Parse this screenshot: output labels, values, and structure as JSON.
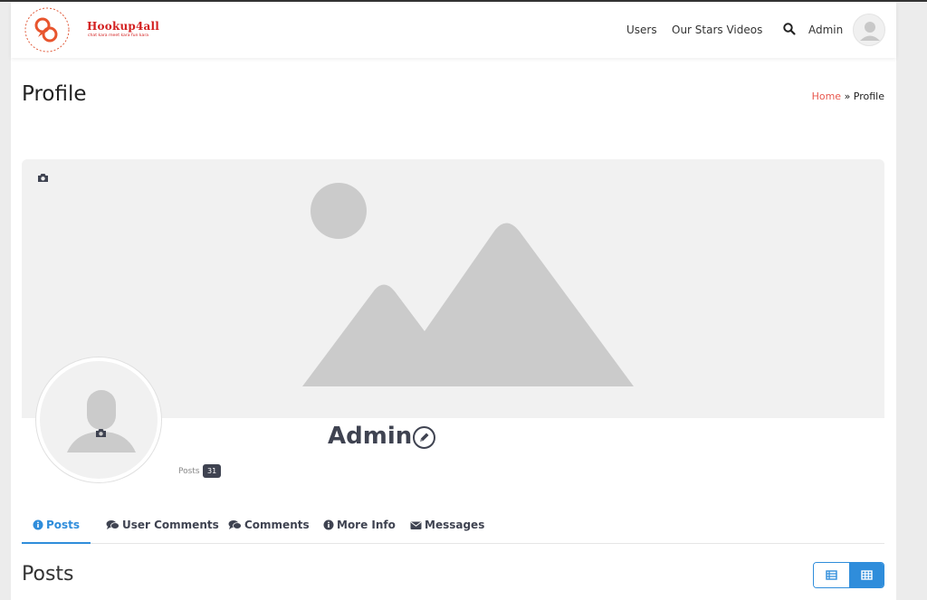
{
  "header": {
    "logo_text": "Hookup4all",
    "logo_tagline": "chat kara meet kara fun kara",
    "nav": {
      "users": "Users",
      "stars_videos": "Our Stars Videos",
      "admin": "Admin"
    }
  },
  "page_title": "Profile",
  "breadcrumb": {
    "home": "Home",
    "separator": "»",
    "current": "Profile"
  },
  "profile": {
    "name": "Admin",
    "stats": {
      "posts_label": "Posts",
      "posts_count": "31"
    }
  },
  "tabs": [
    {
      "label": "Posts",
      "icon": "info-icon",
      "active": true
    },
    {
      "label": "User Comments",
      "icon": "comments-icon",
      "active": false
    },
    {
      "label": "Comments",
      "icon": "comments-icon",
      "active": false
    },
    {
      "label": "More Info",
      "icon": "info-icon",
      "active": false
    },
    {
      "label": "Messages",
      "icon": "envelope-icon",
      "active": false
    }
  ],
  "section_title": "Posts",
  "colors": {
    "accent": "#2f8ddb",
    "brand": "#d32020",
    "breadcrumb_link": "#e8574d",
    "badge": "#3f4351"
  }
}
